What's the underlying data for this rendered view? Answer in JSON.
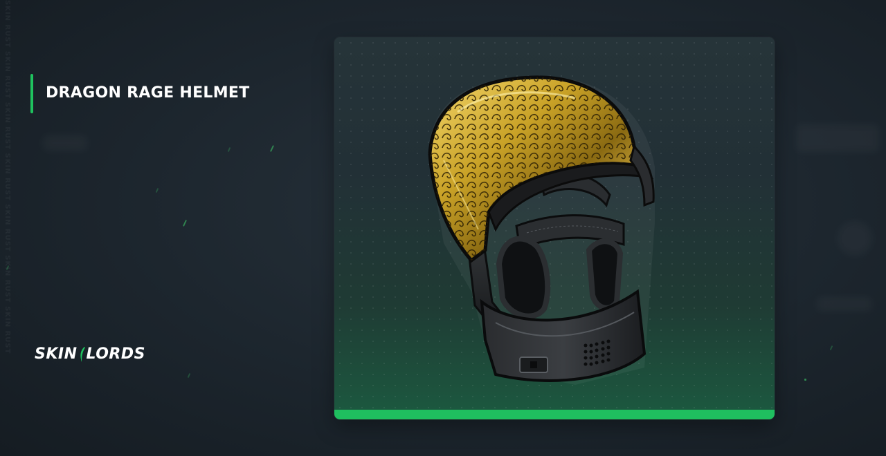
{
  "item": {
    "title": "DRAGON RAGE HELMET"
  },
  "brand": {
    "logo_left": "SKIN",
    "logo_right": "LORDS"
  },
  "watermark": {
    "text": "SKIN RUST SKIN RUST SKIN RUST SKIN RUST SKIN RUST SKIN RUST SKIN RUST"
  },
  "colors": {
    "background": "#1c252d",
    "accent_green": "#1fc25e",
    "card_top": "#263439",
    "card_bottom": "#1c5a40",
    "gold": "#c9a227"
  },
  "icons": {
    "item_image": "helmet-icon"
  }
}
